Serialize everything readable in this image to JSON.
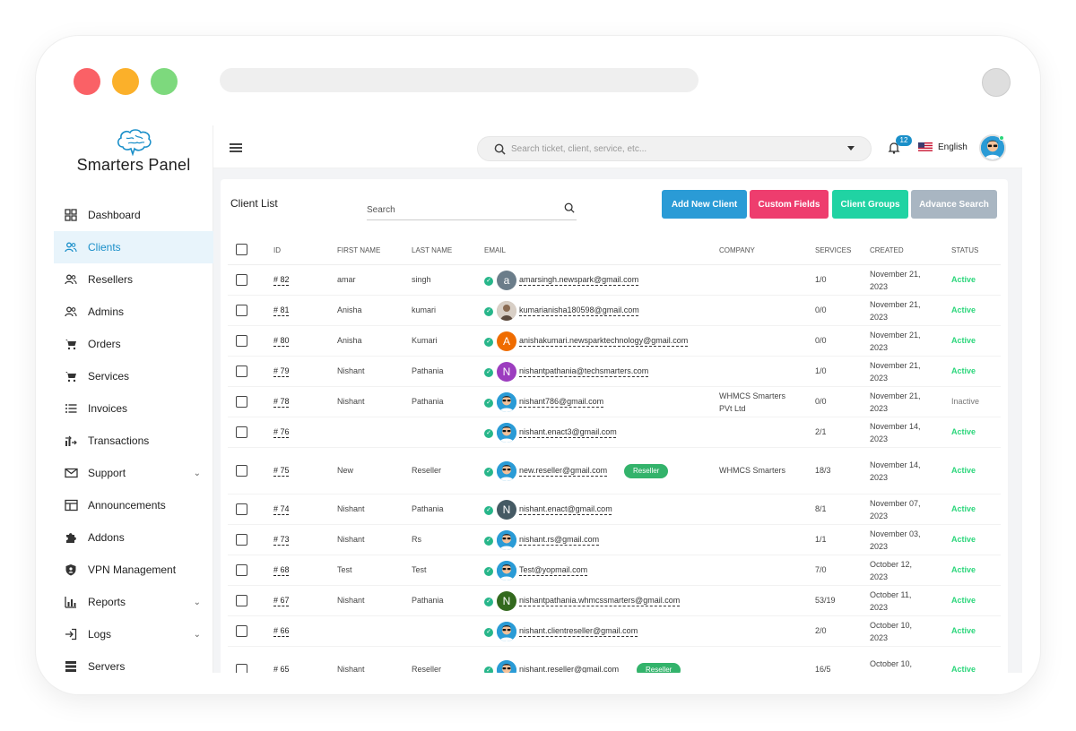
{
  "colors": {
    "accent": "#1a8fc9",
    "active": "#2bd67b",
    "add_btn": "#2a9bd6",
    "custom_btn": "#ee3d6e",
    "groups_btn": "#20d3a3",
    "advance_btn": "#a9b6c2"
  },
  "brand": {
    "name": "Smarters Panel"
  },
  "sidebar": {
    "items": [
      {
        "label": "Dashboard",
        "icon": "dashboard-icon"
      },
      {
        "label": "Clients",
        "icon": "users-icon",
        "active": true
      },
      {
        "label": "Resellers",
        "icon": "users-icon"
      },
      {
        "label": "Admins",
        "icon": "users-icon"
      },
      {
        "label": "Orders",
        "icon": "cart-icon"
      },
      {
        "label": "Services",
        "icon": "cart-icon"
      },
      {
        "label": "Invoices",
        "icon": "list-icon"
      },
      {
        "label": "Transactions",
        "icon": "transactions-icon"
      },
      {
        "label": "Support",
        "icon": "mail-icon",
        "chevron": true
      },
      {
        "label": "Announcements",
        "icon": "announcement-icon"
      },
      {
        "label": "Addons",
        "icon": "puzzle-icon"
      },
      {
        "label": "VPN Management",
        "icon": "shield-icon"
      },
      {
        "label": "Reports",
        "icon": "chart-icon",
        "chevron": true
      },
      {
        "label": "Logs",
        "icon": "login-icon",
        "chevron": true
      },
      {
        "label": "Servers",
        "icon": "server-icon"
      }
    ]
  },
  "topbar": {
    "search_placeholder": "Search ticket, client, service, etc...",
    "notifications": "12",
    "language": "English"
  },
  "client_list": {
    "title": "Client List",
    "search_placeholder": "Search",
    "buttons": {
      "add": "Add New Client",
      "custom": "Custom Fields",
      "groups": "Client Groups",
      "advance": "Advance Search"
    },
    "columns": {
      "id": "ID",
      "first": "First Name",
      "last": "Last Name",
      "email": "Email",
      "company": "Company",
      "services": "Services",
      "created": "Created",
      "status": "Status"
    },
    "rows": [
      {
        "id": "# 82",
        "first": "amar",
        "last": "singh",
        "email": "amarsingh.newspark@gmail.com",
        "avatar": "a",
        "avatar_color": "#6b7d8a",
        "company": "",
        "services": "1/0",
        "created1": "November 21,",
        "created2": "2023",
        "status": "Active"
      },
      {
        "id": "# 81",
        "first": "Anisha",
        "last": "kumari",
        "email": "kumarianisha180598@gmail.com",
        "avatar": "",
        "avatar_color": "#b9a89a",
        "company": "",
        "services": "0/0",
        "created1": "November 21,",
        "created2": "2023",
        "status": "Active"
      },
      {
        "id": "# 80",
        "first": "Anisha",
        "last": "Kumari",
        "email": "anishakumari.newsparktechnology@gmail.com",
        "avatar": "A",
        "avatar_color": "#ef6c00",
        "company": "",
        "services": "0/0",
        "created1": "November 21,",
        "created2": "2023",
        "status": "Active"
      },
      {
        "id": "# 79",
        "first": "Nishant",
        "last": "Pathania",
        "email": "nishantpathania@techsmarters.com",
        "avatar": "N",
        "avatar_color": "#9c3dbf",
        "company": "",
        "services": "1/0",
        "created1": "November 21,",
        "created2": "2023",
        "status": "Active"
      },
      {
        "id": "# 78",
        "first": "Nishant",
        "last": "Pathania",
        "email": "nishant786@gmail.com",
        "avatar": "",
        "avatar_color": "#2a9bd6",
        "company": "WHMCS Smarters",
        "company2": "PVt Ltd",
        "services": "0/0",
        "created1": "November 21,",
        "created2": "2023",
        "status": "Inactive"
      },
      {
        "id": "# 76",
        "first": "",
        "last": "",
        "email": "nishant.enact3@gmail.com",
        "avatar": "",
        "avatar_color": "#2a9bd6",
        "company": "",
        "services": "2/1",
        "created1": "November 14,",
        "created2": "2023",
        "status": "Active"
      },
      {
        "id": "# 75",
        "first": "New",
        "last": "Reseller",
        "email": "new.reseller@gmail.com",
        "avatar": "",
        "avatar_color": "#2a9bd6",
        "tag": "Reseller",
        "company": "WHMCS Smarters",
        "services": "18/3",
        "created1": "November 14,",
        "created2": "2023",
        "status": "Active"
      },
      {
        "id": "# 74",
        "first": "Nishant",
        "last": "Pathania",
        "email": "nishant.enact@gmail.com",
        "avatar": "N",
        "avatar_color": "#455a64",
        "company": "",
        "services": "8/1",
        "created1": "November 07,",
        "created2": "2023",
        "status": "Active"
      },
      {
        "id": "# 73",
        "first": "Nishant",
        "last": "Rs",
        "email": "nishant.rs@gmail.com",
        "avatar": "",
        "avatar_color": "#2a9bd6",
        "company": "",
        "services": "1/1",
        "created1": "November 03,",
        "created2": "2023",
        "status": "Active"
      },
      {
        "id": "# 68",
        "first": "Test",
        "last": "Test",
        "email": "Test@yopmail.com",
        "avatar": "",
        "avatar_color": "#2a9bd6",
        "company": "",
        "services": "7/0",
        "created1": "October 12,",
        "created2": "2023",
        "status": "Active"
      },
      {
        "id": "# 67",
        "first": "Nishant",
        "last": "Pathania",
        "email": "nishantpathania.whmcssmarters@gmail.com",
        "avatar": "N",
        "avatar_color": "#33691e",
        "company": "",
        "services": "53/19",
        "created1": "October 11,",
        "created2": "2023",
        "status": "Active"
      },
      {
        "id": "# 66",
        "first": "",
        "last": "",
        "email": "nishant.clientreseller@gmail.com",
        "avatar": "",
        "avatar_color": "#2a9bd6",
        "company": "",
        "services": "2/0",
        "created1": "October 10,",
        "created2": "2023",
        "status": "Active"
      },
      {
        "id": "# 65",
        "first": "Nishant",
        "last": "Reseller",
        "email": "nishant.reseller@gmail.com",
        "avatar": "",
        "avatar_color": "#2a9bd6",
        "tag": "Reseller",
        "company": "",
        "services": "16/5",
        "created1": "October 10,",
        "created2": "",
        "status": "Active"
      }
    ]
  }
}
